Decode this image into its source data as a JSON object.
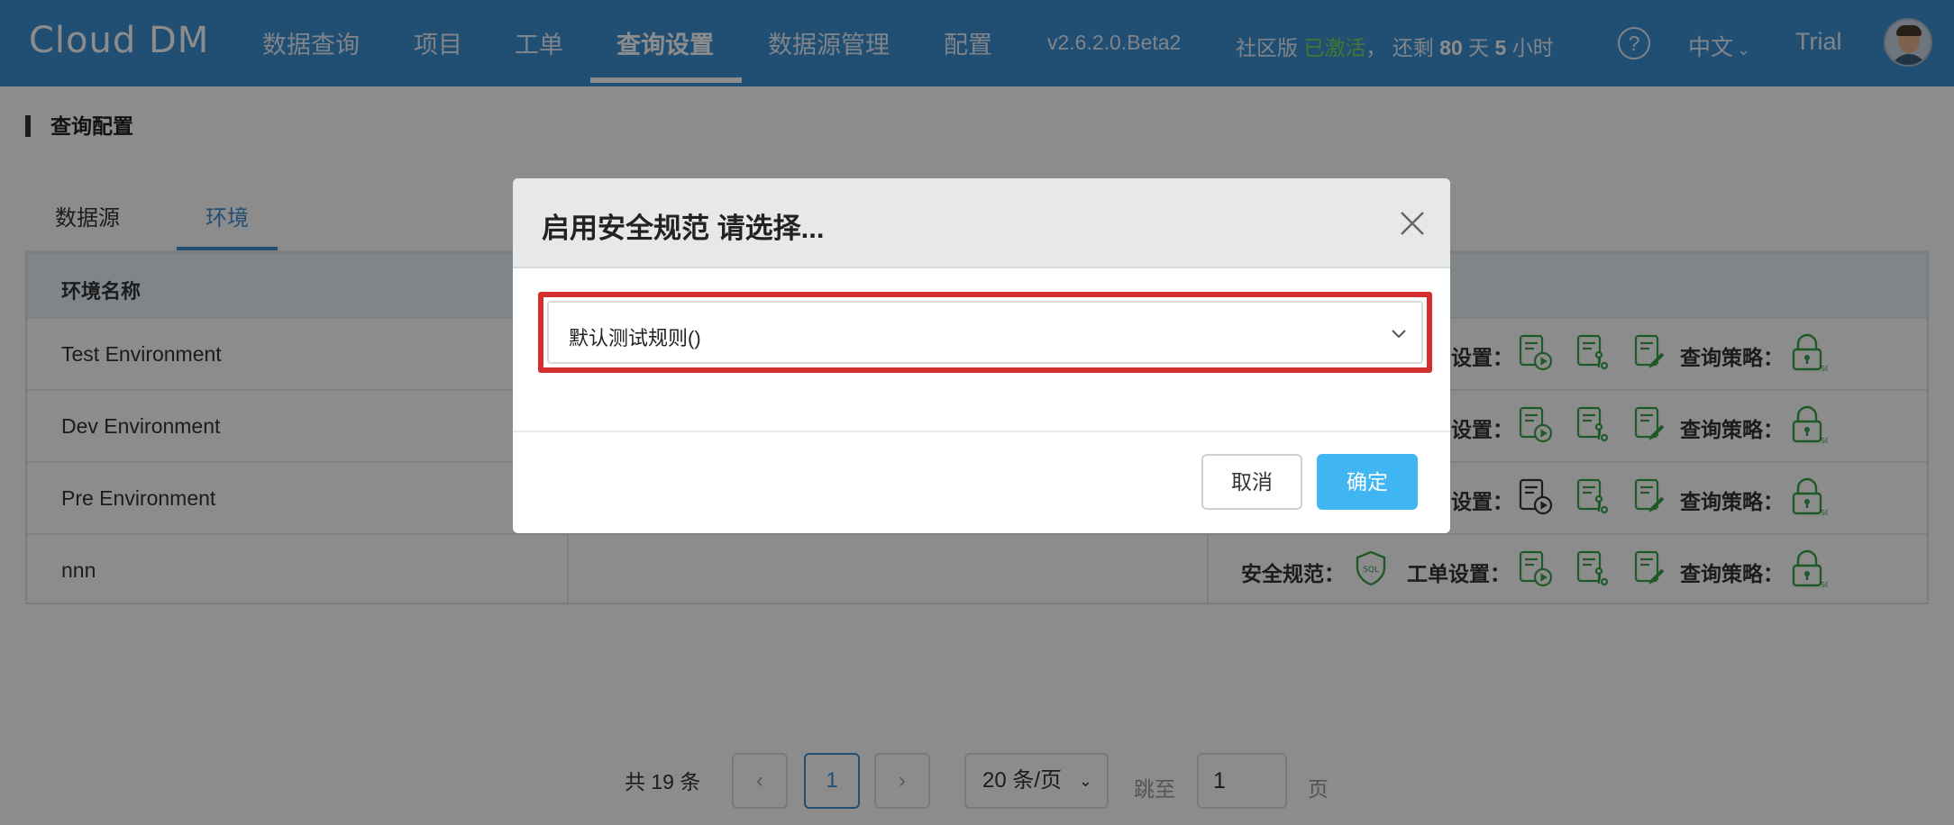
{
  "app": {
    "logo": "Cloud DM"
  },
  "nav": {
    "items": [
      {
        "label": "数据查询"
      },
      {
        "label": "项目"
      },
      {
        "label": "工单"
      },
      {
        "label": "查询设置"
      },
      {
        "label": "数据源管理"
      },
      {
        "label": "配置"
      }
    ],
    "active_index": 3,
    "version": "v2.6.2.0.Beta2",
    "edition": "社区版",
    "activated": "已激活",
    "remaining_prefix": "， 还剩",
    "remaining_days": "80",
    "days_unit": "天",
    "remaining_hours": "5",
    "hours_unit": "小时",
    "help": "?",
    "language": "中文",
    "trial": "Trial"
  },
  "page": {
    "section_title": "查询配置",
    "tabs": [
      {
        "label": "数据源"
      },
      {
        "label": "环境"
      }
    ],
    "active_tab_index": 1
  },
  "table": {
    "header": {
      "name": "环境名称"
    },
    "rows": [
      {
        "name": "Test Environment"
      },
      {
        "name": "Dev Environment"
      },
      {
        "name": "Pre Environment"
      },
      {
        "name": "nnn"
      }
    ],
    "ops": {
      "security_label": "安全规范：",
      "order_settings_partial": "设置：",
      "order_settings_label": "工单设置：",
      "query_policy_label": "查询策略：",
      "sql_badge": "SQL"
    },
    "accent_color": "#3aa24a"
  },
  "pagination": {
    "total": "共 19 条",
    "prev": "‹",
    "current_page": "1",
    "next": "›",
    "page_size": "20 条/页",
    "jump_label": "跳至",
    "jump_value": "1",
    "page_unit": "页"
  },
  "modal": {
    "title": "启用安全规范 请选择...",
    "select_value": "默认测试规则()",
    "cancel_label": "取消",
    "ok_label": "确定",
    "ok_color": "#3fb6f2",
    "highlight_color": "#d32f2f"
  }
}
